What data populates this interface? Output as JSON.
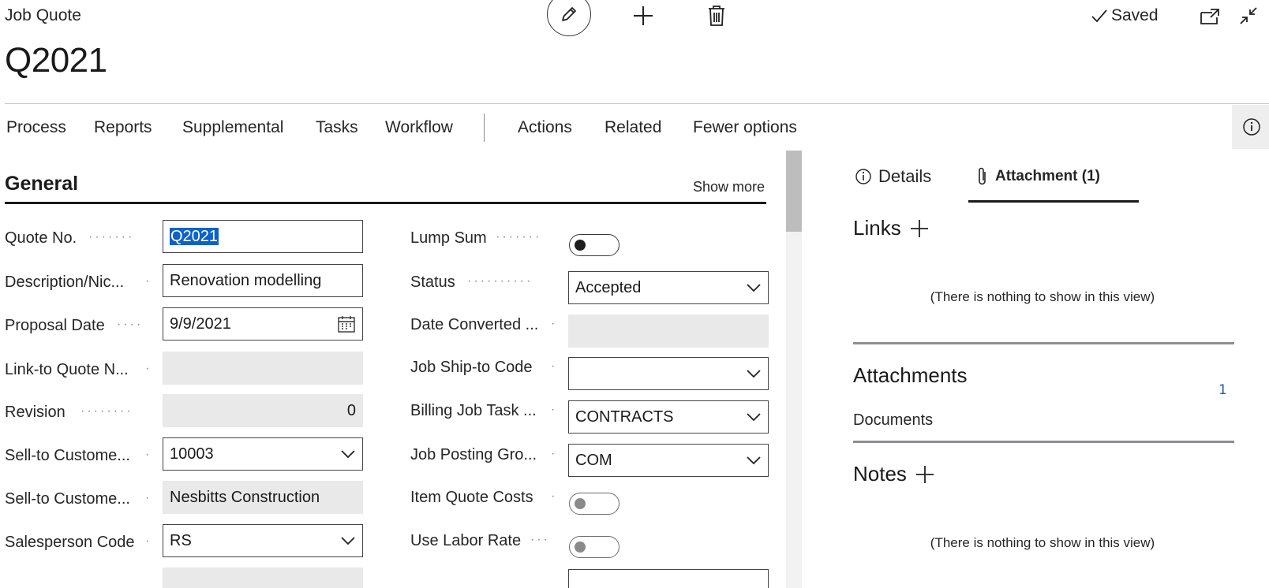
{
  "header": {
    "caption": "Job Quote",
    "title": "Q2021",
    "saved_label": "Saved"
  },
  "actionbar": {
    "items": [
      "Process",
      "Reports",
      "Supplemental",
      "Tasks",
      "Workflow",
      "Actions",
      "Related",
      "Fewer options"
    ]
  },
  "general": {
    "title": "General",
    "show_more": "Show more",
    "left_fields": [
      {
        "label": "Quote No.",
        "value": "Q2021",
        "kind": "text-selected"
      },
      {
        "label": "Description/Nic...",
        "value": "Renovation modelling",
        "kind": "text"
      },
      {
        "label": "Proposal Date",
        "value": "9/9/2021",
        "kind": "date"
      },
      {
        "label": "Link-to Quote N...",
        "value": "",
        "kind": "readonly"
      },
      {
        "label": "Revision",
        "value": "0",
        "kind": "readonly-num"
      },
      {
        "label": "Sell-to Custome...",
        "value": "10003",
        "kind": "lookup"
      },
      {
        "label": "Sell-to Custome...",
        "value": "Nesbitts Construction",
        "kind": "readonly"
      },
      {
        "label": "Salesperson Code",
        "value": "RS",
        "kind": "lookup"
      }
    ],
    "right_fields": [
      {
        "label": "Lump Sum",
        "kind": "toggle",
        "on": true
      },
      {
        "label": "Status",
        "value": "Accepted",
        "kind": "select"
      },
      {
        "label": "Date Converted ...",
        "value": "",
        "kind": "readonly"
      },
      {
        "label": "Job Ship-to Code",
        "value": "",
        "kind": "lookup"
      },
      {
        "label": "Billing Job Task ...",
        "value": "CONTRACTS",
        "kind": "lookup"
      },
      {
        "label": "Job Posting Gro...",
        "value": "COM",
        "kind": "lookup"
      },
      {
        "label": "Item Quote Costs",
        "kind": "toggle",
        "on": false
      },
      {
        "label": "Use Labor Rate",
        "kind": "toggle",
        "on": false
      }
    ]
  },
  "factbox": {
    "tabs": {
      "details": "Details",
      "attachment": "Attachment (1)"
    },
    "links_title": "Links",
    "links_empty": "(There is nothing to show in this view)",
    "attachments_title": "Attachments",
    "attachments_count": "1",
    "documents_label": "Documents",
    "notes_title": "Notes",
    "notes_empty": "(There is nothing to show in this view)"
  }
}
